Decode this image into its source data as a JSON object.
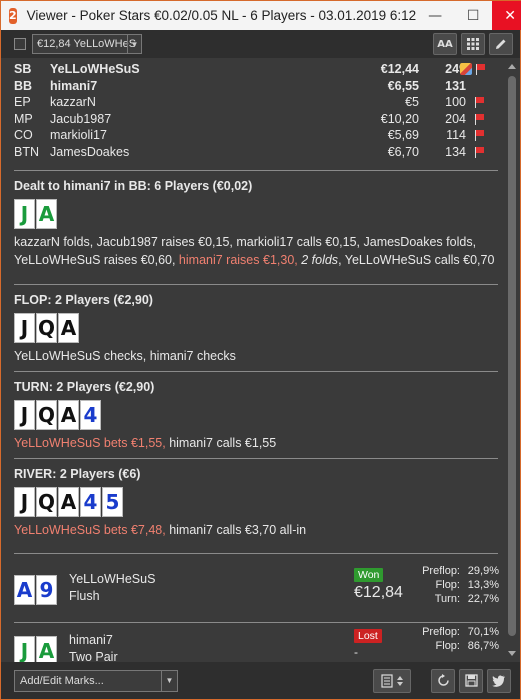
{
  "window": {
    "title": "Viewer - Poker Stars €0.02/0.05 NL - 6 Players - 03.01.2019 6:12",
    "app_icon": "2",
    "minimize": "—",
    "maximize": "☐",
    "close": "✕"
  },
  "toolbar": {
    "player_select": "€12,84 YeLLoWHeS",
    "font_btn": "AA",
    "grid_icon": "grid-icon",
    "edit_icon": "pencil-icon"
  },
  "players": [
    {
      "pos": "SB",
      "name": "YeLLoWHeSuS",
      "stack": "€12,44",
      "hands": "249",
      "bold": true,
      "note": true,
      "flag": true
    },
    {
      "pos": "BB",
      "name": "himani7",
      "stack": "€6,55",
      "hands": "131",
      "bold": true,
      "note": false,
      "flag": false
    },
    {
      "pos": "EP",
      "name": "kazzarN",
      "stack": "€5",
      "hands": "100",
      "bold": false,
      "note": false,
      "flag": true
    },
    {
      "pos": "MP",
      "name": "Jacub1987",
      "stack": "€10,20",
      "hands": "204",
      "bold": false,
      "note": false,
      "flag": true
    },
    {
      "pos": "CO",
      "name": "markioli17",
      "stack": "€5,69",
      "hands": "114",
      "bold": false,
      "note": false,
      "flag": true
    },
    {
      "pos": "BTN",
      "name": "JamesDoakes",
      "stack": "€6,70",
      "hands": "134",
      "bold": false,
      "note": false,
      "flag": true
    }
  ],
  "preflop": {
    "title": "Dealt to himani7 in BB: 6 Players (€0,02)",
    "cards": [
      {
        "rank": "J",
        "color": "green"
      },
      {
        "rank": "A",
        "color": "green"
      }
    ],
    "line1": "kazzarN folds, Jacub1987 raises €0,15, markioli17 calls €0,15, JamesDoakes folds,",
    "line2a": "YeLLoWHeSuS raises €0,60, ",
    "line2b": "himani7 raises €1,30, ",
    "line2c": "2 folds",
    "line2d": ", YeLLoWHeSuS calls €0,70"
  },
  "flop": {
    "title": "FLOP: 2 Players (€2,90)",
    "cards": [
      {
        "rank": "J",
        "color": "black"
      },
      {
        "rank": "Q",
        "color": "black"
      },
      {
        "rank": "A",
        "color": "black"
      }
    ],
    "line1": "YeLLoWHeSuS checks, himani7 checks"
  },
  "turn": {
    "title": "TURN: 2 Players (€2,90)",
    "cards": [
      {
        "rank": "J",
        "color": "black"
      },
      {
        "rank": "Q",
        "color": "black"
      },
      {
        "rank": "A",
        "color": "black"
      },
      {
        "rank": "4",
        "color": "blue"
      }
    ],
    "line1a": "YeLLoWHeSuS bets €1,55, ",
    "line1b": "himani7 calls €1,55"
  },
  "river": {
    "title": "RIVER: 2 Players (€6)",
    "cards": [
      {
        "rank": "J",
        "color": "black"
      },
      {
        "rank": "Q",
        "color": "black"
      },
      {
        "rank": "A",
        "color": "black"
      },
      {
        "rank": "4",
        "color": "blue"
      },
      {
        "rank": "5",
        "color": "blue"
      }
    ],
    "line1a": "YeLLoWHeSuS bets €7,48, ",
    "line1b": "himani7 calls €3,70 all-in"
  },
  "results": [
    {
      "name": "YeLLoWHeSuS",
      "hand": "Flush",
      "badge": "Won",
      "amount": "€12,84",
      "cards": [
        {
          "rank": "A",
          "color": "blue"
        },
        {
          "rank": "9",
          "color": "blue"
        }
      ],
      "stats": [
        {
          "label": "Preflop:",
          "value": "29,9%"
        },
        {
          "label": "Flop:",
          "value": "13,3%"
        },
        {
          "label": "Turn:",
          "value": "22,7%"
        }
      ]
    },
    {
      "name": "himani7",
      "hand": "Two Pair",
      "badge": "Lost",
      "amount": "-",
      "cards": [
        {
          "rank": "J",
          "color": "green"
        },
        {
          "rank": "A",
          "color": "green"
        }
      ],
      "stats": [
        {
          "label": "Preflop:",
          "value": "70,1%"
        },
        {
          "label": "Flop:",
          "value": "86,7%"
        }
      ]
    }
  ],
  "bottombar": {
    "marks_select": "Add/Edit Marks...",
    "notes_icon": "notes-icon",
    "replay_icon": "replay-icon",
    "save_icon": "save-icon",
    "twitter_icon": "twitter-icon"
  }
}
